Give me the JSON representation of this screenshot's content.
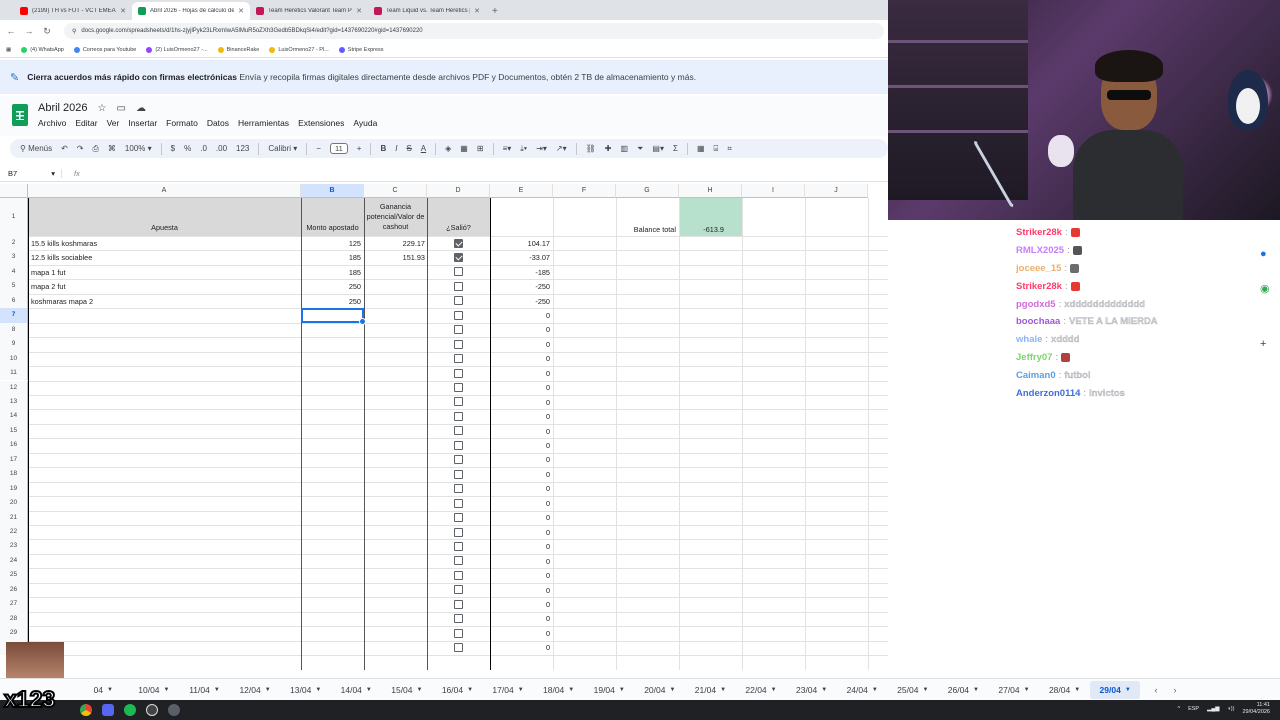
{
  "browser": {
    "tabs": [
      {
        "label": "(2199) TH vs FUT - VCT EMEA",
        "color": "#ff0000",
        "active": false
      },
      {
        "label": "Abril 2026 - Hojas de cálculo de",
        "color": "#0f9d58",
        "active": true
      },
      {
        "label": "Team Heretics Valorant Team P",
        "color": "#c2185b",
        "active": false
      },
      {
        "label": "Team Liquid vs. Team Heretics |",
        "color": "#c2185b",
        "active": false
      }
    ],
    "new_tab": "+",
    "url": "docs.google.com/spreadsheets/d/1hs-zjyjlPyk23LRxmIwA5lMuR5oZXh3Gedb5BDkqSi4/edit?gid=1437690220#gid=1437690220",
    "bookmarks": [
      {
        "label": "(4) WhatsApp",
        "color": "#25d366"
      },
      {
        "label": "Correos para Youtube",
        "color": "#4285f4"
      },
      {
        "label": "(2) LuisOrmeno27 -...",
        "color": "#9146ff"
      },
      {
        "label": "BinanceRake",
        "color": "#f0b90b"
      },
      {
        "label": "LuisOrmeno27 - Pl...",
        "color": "#f0b90b"
      },
      {
        "label": "Stripe Express",
        "color": "#635bff"
      }
    ]
  },
  "banner": {
    "bold": "Cierra acuerdos más rápido con firmas electrónicas",
    "rest": "Envía y recopila firmas digitales directamente desde archivos PDF y Documentos, obtén 2 TB de almacenamiento y más."
  },
  "doc": {
    "title": "Abril 2026",
    "menu": [
      "Archivo",
      "Editar",
      "Ver",
      "Insertar",
      "Formato",
      "Datos",
      "Herramientas",
      "Extensiones",
      "Ayuda"
    ]
  },
  "toolbar": {
    "menus": "Menús",
    "zoom": "100%",
    "currency": "$",
    "percent": "%",
    "dec_less": ".0",
    "dec_more": ".00",
    "format_123": "123",
    "font": "Calibri",
    "minus": "−",
    "font_size": "11",
    "plus": "+",
    "bold": "B",
    "italic": "I",
    "strike": "S",
    "text_color": "A"
  },
  "formula_bar": {
    "cell_ref": "B7",
    "fx": "fx"
  },
  "sheet": {
    "columns": [
      "A",
      "B",
      "C",
      "D",
      "E",
      "F",
      "G",
      "H",
      "I",
      "J"
    ],
    "header": {
      "a": "Apuesta",
      "b": "Monto apostado",
      "c": "Ganancia potencial/Valor de cashout",
      "d": "¿Salió?"
    },
    "balance_label": "Balance total",
    "balance_value": "-613.9",
    "rows": [
      {
        "n": "2",
        "apuesta": "15.5 kills koshmaras",
        "monto": "125",
        "ganancia": "229.17",
        "salio": true,
        "e": "104.17"
      },
      {
        "n": "3",
        "apuesta": "12.5 kills sociablee",
        "monto": "185",
        "ganancia": "151.93",
        "salio": true,
        "e": "-33.07"
      },
      {
        "n": "4",
        "apuesta": "mapa 1 fut",
        "monto": "185",
        "ganancia": "",
        "salio": false,
        "e": "-185"
      },
      {
        "n": "5",
        "apuesta": "mapa 2 fut",
        "monto": "250",
        "ganancia": "",
        "salio": false,
        "e": "-250"
      },
      {
        "n": "6",
        "apuesta": "koshmaras mapa 2",
        "monto": "250",
        "ganancia": "",
        "salio": false,
        "e": "-250"
      },
      {
        "n": "7",
        "apuesta": "",
        "monto": "",
        "ganancia": "",
        "salio": false,
        "e": "0"
      },
      {
        "n": "8",
        "apuesta": "",
        "monto": "",
        "ganancia": "",
        "salio": false,
        "e": "0"
      },
      {
        "n": "9",
        "apuesta": "",
        "monto": "",
        "ganancia": "",
        "salio": false,
        "e": "0"
      },
      {
        "n": "10",
        "apuesta": "",
        "monto": "",
        "ganancia": "",
        "salio": false,
        "e": "0"
      },
      {
        "n": "11",
        "apuesta": "",
        "monto": "",
        "ganancia": "",
        "salio": false,
        "e": "0"
      },
      {
        "n": "12",
        "apuesta": "",
        "monto": "",
        "ganancia": "",
        "salio": false,
        "e": "0"
      },
      {
        "n": "13",
        "apuesta": "",
        "monto": "",
        "ganancia": "",
        "salio": false,
        "e": "0"
      },
      {
        "n": "14",
        "apuesta": "",
        "monto": "",
        "ganancia": "",
        "salio": false,
        "e": "0"
      },
      {
        "n": "15",
        "apuesta": "",
        "monto": "",
        "ganancia": "",
        "salio": false,
        "e": "0"
      },
      {
        "n": "16",
        "apuesta": "",
        "monto": "",
        "ganancia": "",
        "salio": false,
        "e": "0"
      },
      {
        "n": "17",
        "apuesta": "",
        "monto": "",
        "ganancia": "",
        "salio": false,
        "e": "0"
      },
      {
        "n": "18",
        "apuesta": "",
        "monto": "",
        "ganancia": "",
        "salio": false,
        "e": "0"
      },
      {
        "n": "19",
        "apuesta": "",
        "monto": "",
        "ganancia": "",
        "salio": false,
        "e": "0"
      },
      {
        "n": "20",
        "apuesta": "",
        "monto": "",
        "ganancia": "",
        "salio": false,
        "e": "0"
      },
      {
        "n": "21",
        "apuesta": "",
        "monto": "",
        "ganancia": "",
        "salio": false,
        "e": "0"
      },
      {
        "n": "22",
        "apuesta": "",
        "monto": "",
        "ganancia": "",
        "salio": false,
        "e": "0"
      },
      {
        "n": "23",
        "apuesta": "",
        "monto": "",
        "ganancia": "",
        "salio": false,
        "e": "0"
      },
      {
        "n": "24",
        "apuesta": "",
        "monto": "",
        "ganancia": "",
        "salio": false,
        "e": "0"
      },
      {
        "n": "25",
        "apuesta": "",
        "monto": "",
        "ganancia": "",
        "salio": false,
        "e": "0"
      },
      {
        "n": "26",
        "apuesta": "",
        "monto": "",
        "ganancia": "",
        "salio": false,
        "e": "0"
      },
      {
        "n": "27",
        "apuesta": "",
        "monto": "",
        "ganancia": "",
        "salio": false,
        "e": "0"
      },
      {
        "n": "28",
        "apuesta": "",
        "monto": "",
        "ganancia": "",
        "salio": false,
        "e": "0"
      },
      {
        "n": "29",
        "apuesta": "",
        "monto": "",
        "ganancia": "",
        "salio": false,
        "e": "0"
      },
      {
        "n": "",
        "apuesta": "",
        "monto": "",
        "ganancia": "",
        "salio": false,
        "e": "0"
      }
    ]
  },
  "sheet_tabs": [
    "04",
    "10/04",
    "11/04",
    "12/04",
    "13/04",
    "14/04",
    "15/04",
    "16/04",
    "17/04",
    "18/04",
    "19/04",
    "20/04",
    "21/04",
    "22/04",
    "23/04",
    "24/04",
    "25/04",
    "26/04",
    "27/04",
    "28/04",
    "29/04"
  ],
  "active_sheet": "29/04",
  "tray": {
    "lang": "ESP",
    "time": "11:41",
    "date": "29/04/2026"
  },
  "chat": [
    {
      "user": "Striker28k",
      "color": "#ff3b6b",
      "text": "",
      "emote": "#e53935"
    },
    {
      "user": "RMLX2025",
      "color": "#c77dff",
      "text": "",
      "emote": "#555555"
    },
    {
      "user": "joceee_15",
      "color": "#e8b06a",
      "text": "",
      "emote": "#6d6d6d"
    },
    {
      "user": "Striker28k",
      "color": "#ff3b6b",
      "text": "",
      "emote": "#e53935"
    },
    {
      "user": "pgodxd5",
      "color": "#d16bd9",
      "text": "xddddddddddddd"
    },
    {
      "user": "boochaaa",
      "color": "#9b59d9",
      "text": "VETE A LA MIERDA"
    },
    {
      "user": "whale",
      "color": "#8ab4f8",
      "text": "xdddd"
    },
    {
      "user": "Jeffry07",
      "color": "#7bd66b",
      "text": "",
      "emote": "#b0413e"
    },
    {
      "user": "Caiman0",
      "color": "#5aa0e0",
      "text": "futbol"
    },
    {
      "user": "Anderzon0114",
      "color": "#3f6fd8",
      "text": "Invictos"
    }
  ],
  "meme_text": "x123"
}
